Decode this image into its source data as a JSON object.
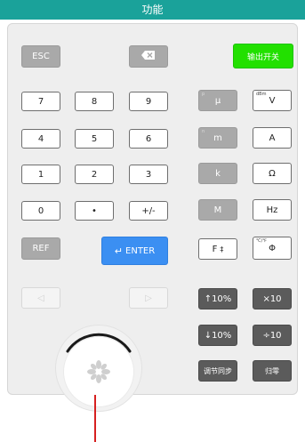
{
  "title": "功能",
  "keys": {
    "esc": "ESC",
    "backspace_icon": "backspace-icon",
    "output_switch": "输出开关",
    "d7": "7",
    "d8": "8",
    "d9": "9",
    "d4": "4",
    "d5": "5",
    "d6": "6",
    "d1": "1",
    "d2": "2",
    "d3": "3",
    "d0": "0",
    "dot": "•",
    "plus_minus": "+/-",
    "mu": "μ",
    "mu_sup": "p",
    "volt": "V",
    "volt_sup": "dBm",
    "milli": "m",
    "milli_sup": "n",
    "amp": "A",
    "kilo": "k",
    "ohm": "Ω",
    "mega": "M",
    "hz": "Hz",
    "ref": "REF",
    "enter": "ENTER",
    "enter_icon": "↵",
    "f_unit": "F",
    "f_unit_glyph": "‡",
    "phase": "Φ",
    "phase_sup": "℃/℉",
    "up10": "↑10%",
    "times10": "×10",
    "down10": "↓10%",
    "div10": "÷10",
    "sync": "调节同步",
    "zero": "归零",
    "nav_left": "◁",
    "nav_right": "▷"
  },
  "colors": {
    "titlebar": "#1aa29a",
    "output_switch": "#22e000",
    "enter": "#3b8ff2",
    "unit_gray": "#a9a9a9",
    "dark_key": "#5b5b5b",
    "pointer": "#d62020"
  }
}
